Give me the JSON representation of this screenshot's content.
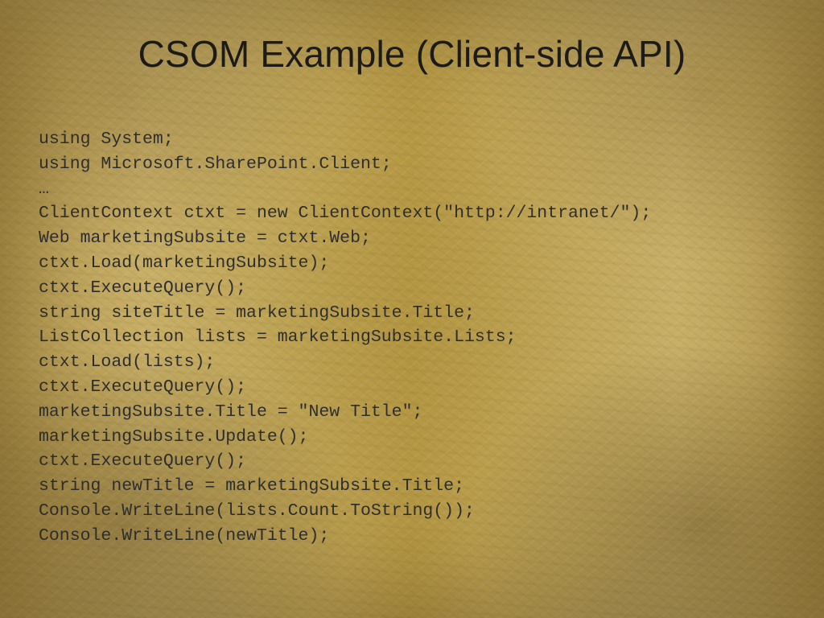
{
  "title": "CSOM Example (Client-side API)",
  "code_lines": [
    "using System;",
    "using Microsoft.SharePoint.Client;",
    "…",
    "ClientContext ctxt = new ClientContext(\"http://intranet/\");",
    "Web marketingSubsite = ctxt.Web;",
    "ctxt.Load(marketingSubsite);",
    "ctxt.ExecuteQuery();",
    "string siteTitle = marketingSubsite.Title;",
    "ListCollection lists = marketingSubsite.Lists;",
    "ctxt.Load(lists);",
    "ctxt.ExecuteQuery();",
    "marketingSubsite.Title = \"New Title\";",
    "marketingSubsite.Update();",
    "ctxt.ExecuteQuery();",
    "string newTitle = marketingSubsite.Title;",
    "Console.WriteLine(lists.Count.ToString());",
    "Console.WriteLine(newTitle);"
  ]
}
